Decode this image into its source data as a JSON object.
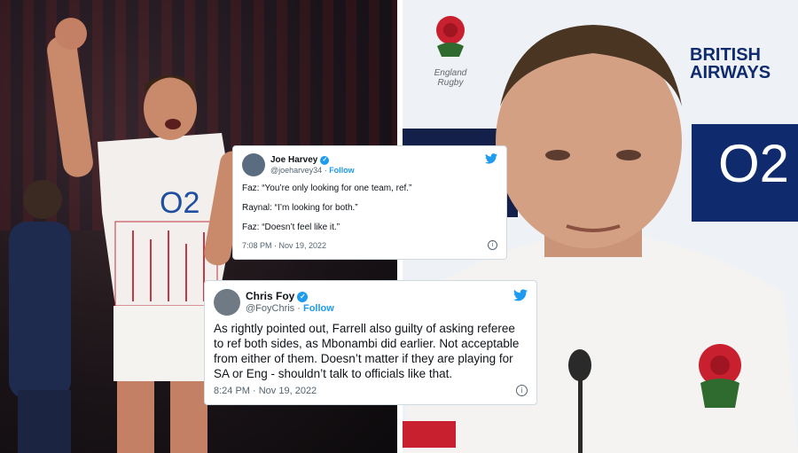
{
  "left_photo": {
    "description": "player celebrating",
    "kit_text": "O2"
  },
  "right_photo": {
    "logo_text": "England Rugby",
    "sponsor_text": "BRITISH AIRWAYS",
    "sponsor_2": "O2"
  },
  "tweets": [
    {
      "name": "Joe Harvey",
      "handle": "@joeharvey34",
      "follow": "Follow",
      "lines": [
        "Faz: “You’re only looking for one team, ref.”",
        "Raynal: “I’m looking for both.”",
        "Faz: “Doesn’t feel like it.”"
      ],
      "timestamp": "7:08 PM · Nov 19, 2022"
    },
    {
      "name": "Chris Foy",
      "handle": "@FoyChris",
      "follow": "Follow",
      "text": "As rightly pointed out, Farrell also guilty of asking referee to ref both sides, as Mbonambi did earlier. Not acceptable from either of them. Doesn’t matter if they are playing for SA or Eng - shouldn’t talk to officials like that.",
      "timestamp": "8:24 PM · Nov 19, 2022"
    }
  ],
  "colors": {
    "twitter_blue": "#1d9bf0",
    "england_navy": "#0f2b6d"
  }
}
